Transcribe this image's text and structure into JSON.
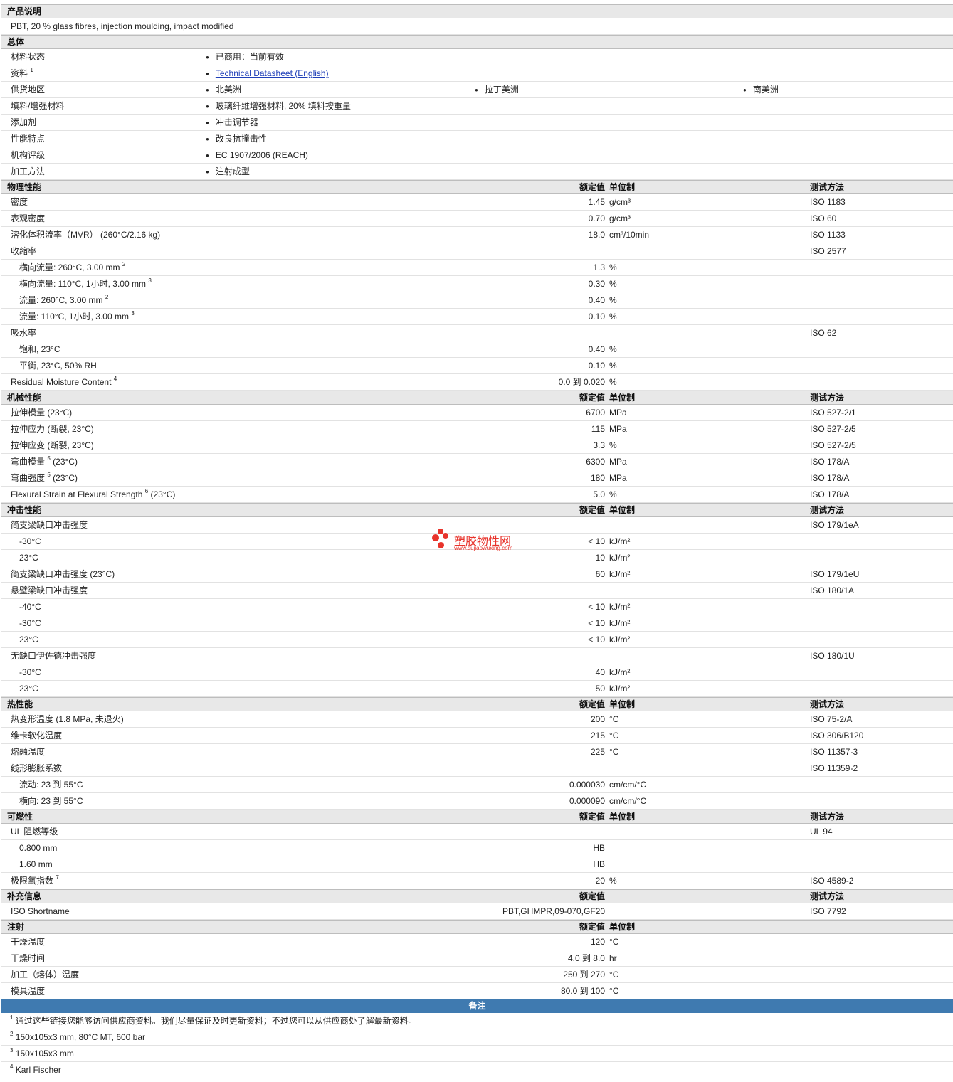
{
  "desc_header": "产品说明",
  "desc_text": "PBT, 20 % glass fibres, injection moulding, impact modified",
  "general": {
    "header": "总体",
    "rows": [
      {
        "label": "材料状态",
        "items": [
          "已商用：当前有效"
        ]
      },
      {
        "label": "资料",
        "sup": "1",
        "link": "Technical Datasheet (English)"
      },
      {
        "label": "供货地区",
        "items": [
          "北美洲",
          "拉丁美洲",
          "南美洲"
        ]
      },
      {
        "label": "填料/增强材料",
        "items": [
          "玻璃纤维增强材料, 20% 填料按重量"
        ]
      },
      {
        "label": "添加剂",
        "items": [
          "冲击调节器"
        ]
      },
      {
        "label": "性能特点",
        "items": [
          "改良抗撞击性"
        ]
      },
      {
        "label": "机构评级",
        "items": [
          "EC 1907/2006 (REACH)"
        ]
      },
      {
        "label": "加工方法",
        "items": [
          "注射成型"
        ]
      }
    ]
  },
  "sections": [
    {
      "title": "物理性能",
      "h_value": "额定值",
      "h_unit": "单位制",
      "h_test": "测试方法",
      "rows": [
        {
          "label": "密度",
          "value": "1.45",
          "unit": "g/cm³",
          "test": "ISO 1183"
        },
        {
          "label": "表观密度",
          "value": "0.70",
          "unit": "g/cm³",
          "test": "ISO 60"
        },
        {
          "label": "溶化体积流率（MVR） (260°C/2.16 kg)",
          "value": "18.0",
          "unit": "cm³/10min",
          "test": "ISO 1133"
        },
        {
          "label": "收缩率",
          "test": "ISO 2577"
        },
        {
          "label": "横向流量: 260°C, 3.00 mm",
          "sup": "2",
          "sub": true,
          "value": "1.3",
          "unit": "%"
        },
        {
          "label": "横向流量: 110°C, 1小时, 3.00 mm",
          "sup": "3",
          "sub": true,
          "value": "0.30",
          "unit": "%"
        },
        {
          "label": "流量: 260°C, 3.00 mm",
          "sup": "2",
          "sub": true,
          "value": "0.40",
          "unit": "%"
        },
        {
          "label": "流量: 110°C, 1小时, 3.00 mm",
          "sup": "3",
          "sub": true,
          "value": "0.10",
          "unit": "%"
        },
        {
          "label": "吸水率",
          "test": "ISO 62"
        },
        {
          "label": "饱和, 23°C",
          "sub": true,
          "value": "0.40",
          "unit": "%"
        },
        {
          "label": "平衡, 23°C, 50% RH",
          "sub": true,
          "value": "0.10",
          "unit": "%"
        },
        {
          "label": "Residual Moisture Content",
          "sup": "4",
          "value": "0.0 到 0.020",
          "unit": "%"
        }
      ]
    },
    {
      "title": "机械性能",
      "h_value": "额定值",
      "h_unit": "单位制",
      "h_test": "测试方法",
      "rows": [
        {
          "label": "拉伸模量 (23°C)",
          "value": "6700",
          "unit": "MPa",
          "test": "ISO 527-2/1"
        },
        {
          "label": "拉伸应力 (断裂, 23°C)",
          "value": "115",
          "unit": "MPa",
          "test": "ISO 527-2/5"
        },
        {
          "label": "拉伸应变 (断裂, 23°C)",
          "value": "3.3",
          "unit": "%",
          "test": "ISO 527-2/5"
        },
        {
          "label": "弯曲模量",
          "sup": "5",
          "suffix": " (23°C)",
          "value": "6300",
          "unit": "MPa",
          "test": "ISO 178/A"
        },
        {
          "label": "弯曲强度",
          "sup": "5",
          "suffix": " (23°C)",
          "value": "180",
          "unit": "MPa",
          "test": "ISO 178/A"
        },
        {
          "label": "Flexural Strain at Flexural Strength",
          "sup": "6",
          "suffix": " (23°C)",
          "value": "5.0",
          "unit": "%",
          "test": "ISO 178/A"
        }
      ]
    },
    {
      "title": "冲击性能",
      "h_value": "额定值",
      "h_unit": "单位制",
      "h_test": "测试方法",
      "rows": [
        {
          "label": "简支梁缺口冲击强度",
          "test": "ISO 179/1eA"
        },
        {
          "label": "-30°C",
          "sub": true,
          "value": "< 10",
          "unit": "kJ/m²"
        },
        {
          "label": "23°C",
          "sub": true,
          "value": "10",
          "unit": "kJ/m²"
        },
        {
          "label": "简支梁缺口冲击强度 (23°C)",
          "value": "60",
          "unit": "kJ/m²",
          "test": "ISO 179/1eU"
        },
        {
          "label": "悬壁梁缺口冲击强度",
          "test": "ISO 180/1A"
        },
        {
          "label": "-40°C",
          "sub": true,
          "value": "< 10",
          "unit": "kJ/m²"
        },
        {
          "label": "-30°C",
          "sub": true,
          "value": "< 10",
          "unit": "kJ/m²"
        },
        {
          "label": "23°C",
          "sub": true,
          "value": "< 10",
          "unit": "kJ/m²"
        },
        {
          "label": "无缺口伊佐德冲击强度",
          "test": "ISO 180/1U"
        },
        {
          "label": "-30°C",
          "sub": true,
          "value": "40",
          "unit": "kJ/m²"
        },
        {
          "label": "23°C",
          "sub": true,
          "value": "50",
          "unit": "kJ/m²"
        }
      ]
    },
    {
      "title": "热性能",
      "h_value": "额定值",
      "h_unit": "单位制",
      "h_test": "测试方法",
      "rows": [
        {
          "label": "热变形温度 (1.8 MPa, 未退火)",
          "value": "200",
          "unit": "°C",
          "test": "ISO 75-2/A"
        },
        {
          "label": "维卡软化温度",
          "value": "215",
          "unit": "°C",
          "test": "ISO 306/B120"
        },
        {
          "label": "熔融温度",
          "value": "225",
          "unit": "°C",
          "test": "ISO 11357-3"
        },
        {
          "label": "线形膨胀系数",
          "test": "ISO 11359-2"
        },
        {
          "label": "流动: 23 到 55°C",
          "sub": true,
          "value": "0.000030",
          "unit": "cm/cm/°C"
        },
        {
          "label": "横向: 23 到 55°C",
          "sub": true,
          "value": "0.000090",
          "unit": "cm/cm/°C"
        }
      ]
    },
    {
      "title": "可燃性",
      "h_value": "额定值",
      "h_unit": "单位制",
      "h_test": "测试方法",
      "rows": [
        {
          "label": "UL 阻燃等级",
          "test": "UL 94"
        },
        {
          "label": "0.800 mm",
          "sub": true,
          "value": "HB"
        },
        {
          "label": "1.60 mm",
          "sub": true,
          "value": "HB"
        },
        {
          "label": "极限氧指数",
          "sup": "7",
          "value": "20",
          "unit": "%",
          "test": "ISO 4589-2"
        }
      ]
    },
    {
      "title": "补充信息",
      "h_value": "额定值",
      "h_unit": "",
      "h_test": "测试方法",
      "rows": [
        {
          "label": "ISO Shortname",
          "value": "PBT,GHMPR,09-070,GF20",
          "test": "ISO 7792"
        }
      ]
    },
    {
      "title": "注射",
      "h_value": "额定值",
      "h_unit": "单位制",
      "h_test": "",
      "rows": [
        {
          "label": "干燥温度",
          "value": "120",
          "unit": "°C"
        },
        {
          "label": "干燥时间",
          "value": "4.0 到 8.0",
          "unit": "hr"
        },
        {
          "label": "加工（熔体）温度",
          "value": "250 到 270",
          "unit": "°C"
        },
        {
          "label": "模具温度",
          "value": "80.0 到 100",
          "unit": "°C"
        }
      ]
    }
  ],
  "notes": {
    "title": "备注",
    "items": [
      {
        "num": "1",
        "text": "通过这些链接您能够访问供应商资料。我们尽量保证及时更新资料；不过您可以从供应商处了解最新资料。"
      },
      {
        "num": "2",
        "text": "150x105x3 mm, 80°C MT, 600 bar"
      },
      {
        "num": "3",
        "text": "150x105x3 mm"
      },
      {
        "num": "4",
        "text": "Karl Fischer"
      }
    ]
  },
  "watermark": {
    "title": "塑胶物性网",
    "url": "www.sujiaowuxing.com",
    "color": "#e8332b"
  }
}
